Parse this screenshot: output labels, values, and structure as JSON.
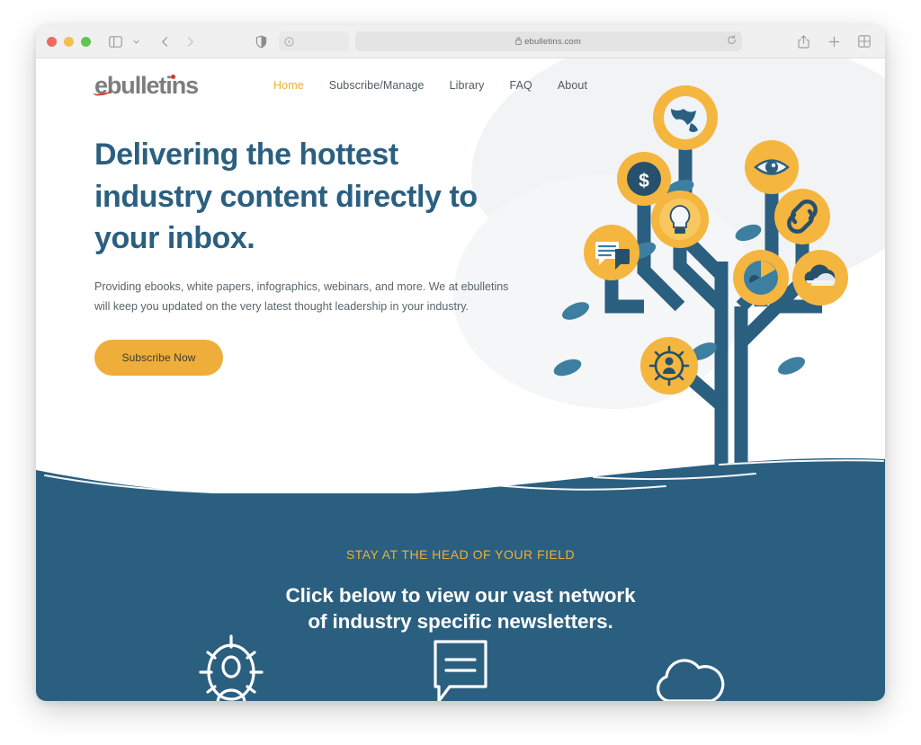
{
  "browser": {
    "traffic_lights": [
      "close",
      "minimize",
      "maximize"
    ],
    "url": "ebulletins.com",
    "lock_glyph": "ὑ2",
    "controls": {
      "sidebar": "sidebar-toggle",
      "sidebar_chevron": "chevron-down",
      "back": "back-arrow",
      "forward": "forward-arrow",
      "shield": "privacy-shield",
      "extension": "extension-badge",
      "reload": "reload",
      "share": "share",
      "new_tab": "new-tab-plus",
      "tab_overview": "tab-overview-grid"
    }
  },
  "site": {
    "logo": {
      "text": "ebulletins",
      "accent_color": "#d8342a"
    },
    "nav": [
      {
        "label": "Home",
        "active": true
      },
      {
        "label": "Subscribe/Manage",
        "active": false
      },
      {
        "label": "Library",
        "active": false
      },
      {
        "label": "FAQ",
        "active": false
      },
      {
        "label": "About",
        "active": false
      }
    ],
    "hero": {
      "title": "Delivering the hottest industry content directly to your inbox.",
      "subtitle": "Providing ebooks, white papers, infographics, webinars, and more. We at ebulletins will keep you updated on the very latest thought leadership in your industry.",
      "cta_label": "Subscribe Now"
    },
    "illustration": {
      "name": "content-tree",
      "leaf_color": "#3d7fa0",
      "branch_color": "#2b5f80",
      "badge_color": "#f4b63f",
      "badges": [
        "globe-icon",
        "eye-icon",
        "dollar-icon",
        "lightbulb-icon",
        "link-chain-icon",
        "chat-bubbles-icon",
        "pie-chart-icon",
        "cloud-icon",
        "user-target-icon"
      ]
    },
    "promo": {
      "eyebrow": "STAY AT THE HEAD OF YOUR FIELD",
      "headline_line_1": "Click below to view our vast network",
      "headline_line_2": "of industry specific newsletters.",
      "feature_icons": [
        "user-target-icon",
        "chat-bubble-icon",
        "cloud-icon"
      ]
    }
  },
  "colors": {
    "brand_blue": "#2b5f80",
    "brand_orange": "#efae39",
    "eyebrow_orange": "#edb033",
    "logo_red": "#d8342a",
    "body_text": "#5a646a"
  }
}
